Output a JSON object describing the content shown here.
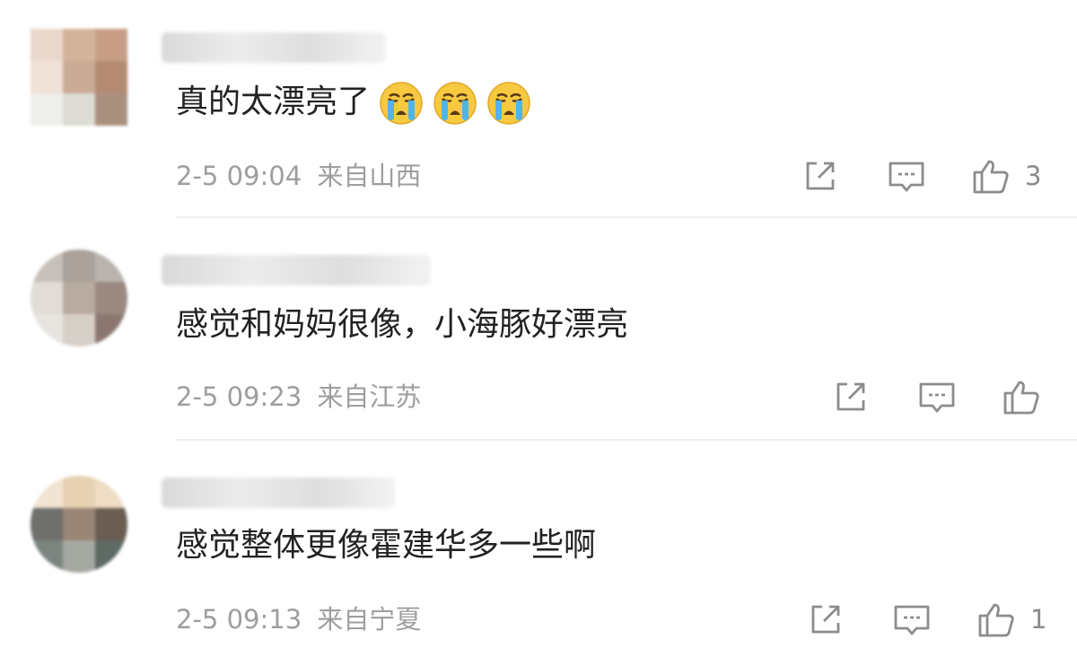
{
  "comments": [
    {
      "text": "真的太漂亮了",
      "emoji": [
        "crying-face",
        "crying-face",
        "crying-face"
      ],
      "time": "2-5 09:04",
      "location": "来自山西",
      "likes": "3"
    },
    {
      "text": "感觉和妈妈很像，小海豚好漂亮",
      "emoji": [],
      "time": "2-5 09:23",
      "location": "来自江苏",
      "likes": ""
    },
    {
      "text": "感觉整体更像霍建华多一些啊",
      "emoji": [],
      "time": "2-5 09:13",
      "location": "来自宁夏",
      "likes": "1"
    }
  ],
  "icons": {
    "share": "share-icon",
    "comment": "comment-icon",
    "like": "thumbs-up-icon"
  },
  "colors": {
    "text": "#222222",
    "meta": "#9e9e9e",
    "icon": "#8c8c8c",
    "divider": "#eeeeee"
  }
}
